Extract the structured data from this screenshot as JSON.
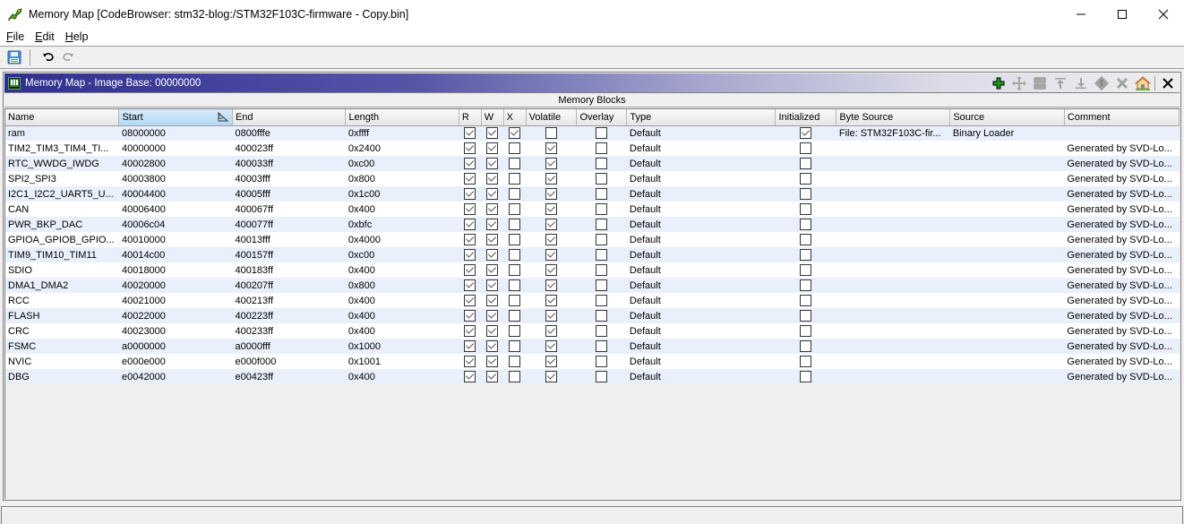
{
  "window": {
    "title": "Memory Map [CodeBrowser: stm32-blog:/STM32F103C-firmware - Copy.bin]",
    "app_icon": "ghidra-dragon-icon",
    "controls": [
      "minimize",
      "maximize",
      "close"
    ]
  },
  "menu": {
    "items": [
      {
        "label": "File",
        "mnemonic": "F",
        "rest": "ile"
      },
      {
        "label": "Edit",
        "mnemonic": "E",
        "rest": "dit"
      },
      {
        "label": "Help",
        "mnemonic": "H",
        "rest": "elp"
      }
    ]
  },
  "toolbar": {
    "buttons": [
      "save-icon",
      "undo-icon",
      "redo-icon"
    ]
  },
  "panel": {
    "title": "Memory Map - Image Base: 00000000",
    "actions": [
      "add-block",
      "move-block",
      "split-block",
      "expand-up",
      "expand-down",
      "merge-blocks",
      "delete-block",
      "set-image-base",
      "close-panel"
    ],
    "section_title": "Memory Blocks"
  },
  "table": {
    "sorted_column": "Start",
    "columns": [
      "Name",
      "Start",
      "End",
      "Length",
      "R",
      "W",
      "X",
      "Volatile",
      "Overlay",
      "Type",
      "Initialized",
      "Byte Source",
      "Source",
      "Comment"
    ],
    "rows": [
      {
        "name": "ram",
        "start": "08000000",
        "end": "0800fffe",
        "length": "0xffff",
        "r": true,
        "w": true,
        "x": true,
        "volatile": false,
        "overlay": false,
        "type": "Default",
        "initialized": true,
        "byte_source": "File: STM32F103C-fir...",
        "source": "Binary Loader",
        "comment": ""
      },
      {
        "name": "TIM2_TIM3_TIM4_TI...",
        "start": "40000000",
        "end": "400023ff",
        "length": "0x2400",
        "r": true,
        "w": true,
        "x": false,
        "volatile": true,
        "overlay": false,
        "type": "Default",
        "initialized": false,
        "byte_source": "",
        "source": "",
        "comment": "Generated by SVD-Lo..."
      },
      {
        "name": "RTC_WWDG_IWDG",
        "start": "40002800",
        "end": "400033ff",
        "length": "0xc00",
        "r": true,
        "w": true,
        "x": false,
        "volatile": true,
        "overlay": false,
        "type": "Default",
        "initialized": false,
        "byte_source": "",
        "source": "",
        "comment": "Generated by SVD-Lo..."
      },
      {
        "name": "SPI2_SPI3",
        "start": "40003800",
        "end": "40003fff",
        "length": "0x800",
        "r": true,
        "w": true,
        "x": false,
        "volatile": true,
        "overlay": false,
        "type": "Default",
        "initialized": false,
        "byte_source": "",
        "source": "",
        "comment": "Generated by SVD-Lo..."
      },
      {
        "name": "I2C1_I2C2_UART5_U...",
        "start": "40004400",
        "end": "40005fff",
        "length": "0x1c00",
        "r": true,
        "w": true,
        "x": false,
        "volatile": true,
        "overlay": false,
        "type": "Default",
        "initialized": false,
        "byte_source": "",
        "source": "",
        "comment": "Generated by SVD-Lo..."
      },
      {
        "name": "CAN",
        "start": "40006400",
        "end": "400067ff",
        "length": "0x400",
        "r": true,
        "w": true,
        "x": false,
        "volatile": true,
        "overlay": false,
        "type": "Default",
        "initialized": false,
        "byte_source": "",
        "source": "",
        "comment": "Generated by SVD-Lo..."
      },
      {
        "name": "PWR_BKP_DAC",
        "start": "40006c04",
        "end": "400077ff",
        "length": "0xbfc",
        "r": true,
        "w": true,
        "x": false,
        "volatile": true,
        "overlay": false,
        "type": "Default",
        "initialized": false,
        "byte_source": "",
        "source": "",
        "comment": "Generated by SVD-Lo..."
      },
      {
        "name": "GPIOA_GPIOB_GPIO...",
        "start": "40010000",
        "end": "40013fff",
        "length": "0x4000",
        "r": true,
        "w": true,
        "x": false,
        "volatile": true,
        "overlay": false,
        "type": "Default",
        "initialized": false,
        "byte_source": "",
        "source": "",
        "comment": "Generated by SVD-Lo..."
      },
      {
        "name": "TIM9_TIM10_TIM11",
        "start": "40014c00",
        "end": "400157ff",
        "length": "0xc00",
        "r": true,
        "w": true,
        "x": false,
        "volatile": true,
        "overlay": false,
        "type": "Default",
        "initialized": false,
        "byte_source": "",
        "source": "",
        "comment": "Generated by SVD-Lo..."
      },
      {
        "name": "SDIO",
        "start": "40018000",
        "end": "400183ff",
        "length": "0x400",
        "r": true,
        "w": true,
        "x": false,
        "volatile": true,
        "overlay": false,
        "type": "Default",
        "initialized": false,
        "byte_source": "",
        "source": "",
        "comment": "Generated by SVD-Lo..."
      },
      {
        "name": "DMA1_DMA2",
        "start": "40020000",
        "end": "400207ff",
        "length": "0x800",
        "r": true,
        "w": true,
        "x": false,
        "volatile": true,
        "overlay": false,
        "type": "Default",
        "initialized": false,
        "byte_source": "",
        "source": "",
        "comment": "Generated by SVD-Lo..."
      },
      {
        "name": "RCC",
        "start": "40021000",
        "end": "400213ff",
        "length": "0x400",
        "r": true,
        "w": true,
        "x": false,
        "volatile": true,
        "overlay": false,
        "type": "Default",
        "initialized": false,
        "byte_source": "",
        "source": "",
        "comment": "Generated by SVD-Lo..."
      },
      {
        "name": "FLASH",
        "start": "40022000",
        "end": "400223ff",
        "length": "0x400",
        "r": true,
        "w": true,
        "x": false,
        "volatile": true,
        "overlay": false,
        "type": "Default",
        "initialized": false,
        "byte_source": "",
        "source": "",
        "comment": "Generated by SVD-Lo..."
      },
      {
        "name": "CRC",
        "start": "40023000",
        "end": "400233ff",
        "length": "0x400",
        "r": true,
        "w": true,
        "x": false,
        "volatile": true,
        "overlay": false,
        "type": "Default",
        "initialized": false,
        "byte_source": "",
        "source": "",
        "comment": "Generated by SVD-Lo..."
      },
      {
        "name": "FSMC",
        "start": "a0000000",
        "end": "a0000fff",
        "length": "0x1000",
        "r": true,
        "w": true,
        "x": false,
        "volatile": true,
        "overlay": false,
        "type": "Default",
        "initialized": false,
        "byte_source": "",
        "source": "",
        "comment": "Generated by SVD-Lo..."
      },
      {
        "name": "NVIC",
        "start": "e000e000",
        "end": "e000f000",
        "length": "0x1001",
        "r": true,
        "w": true,
        "x": false,
        "volatile": true,
        "overlay": false,
        "type": "Default",
        "initialized": false,
        "byte_source": "",
        "source": "",
        "comment": "Generated by SVD-Lo..."
      },
      {
        "name": "DBG",
        "start": "e0042000",
        "end": "e00423ff",
        "length": "0x400",
        "r": true,
        "w": true,
        "x": false,
        "volatile": true,
        "overlay": false,
        "type": "Default",
        "initialized": false,
        "byte_source": "",
        "source": "",
        "comment": "Generated by SVD-Lo..."
      }
    ]
  },
  "status": {
    "text": ""
  },
  "colors": {
    "header_gradient_start": "#2f2f8f",
    "row_alt": "#e9f0fb",
    "sorted_header": "#b2d7f5",
    "add_icon": "#1a9a1a"
  }
}
